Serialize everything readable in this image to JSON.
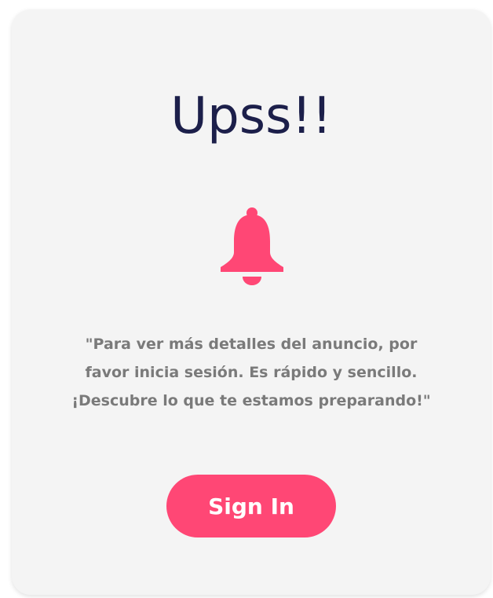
{
  "card": {
    "title": "Upss!!",
    "icon": "bell-icon",
    "message": "\"Para ver más detalles del anuncio, por favor inicia sesión. Es rápido y sencillo. ¡Descubre lo que te estamos preparando!\"",
    "signin_label": "Sign In"
  },
  "colors": {
    "title": "#1c1f4a",
    "accent": "#ff4775",
    "message": "#7a7a7a"
  }
}
